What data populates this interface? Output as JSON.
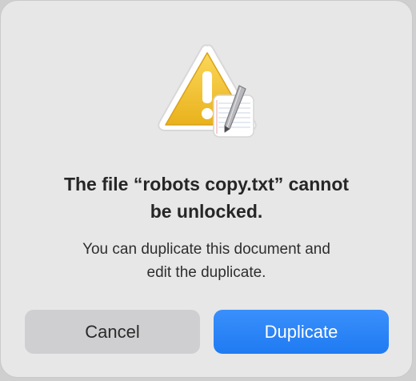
{
  "dialog": {
    "icon": "caution-triangle-with-textedit-document-icon",
    "title_lines": [
      "The file “robots copy.txt” cannot",
      "be unlocked."
    ],
    "message_lines": [
      "You can duplicate this document and",
      "edit the duplicate."
    ],
    "buttons": {
      "cancel_label": "Cancel",
      "duplicate_label": "Duplicate"
    }
  },
  "colors": {
    "background": "#e7e7e8",
    "accent": "#2b86f8",
    "warning": "#f0bf2e",
    "cancel_button": "#cfcfd1"
  }
}
